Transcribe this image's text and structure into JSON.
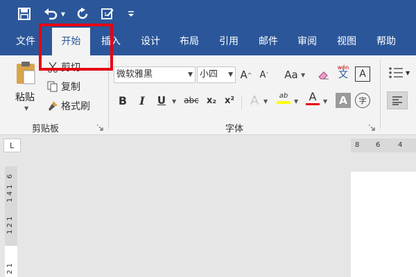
{
  "quick_access": {
    "icons": [
      "save-icon",
      "undo-icon",
      "redo-icon",
      "touch-mode-icon",
      "customize-icon"
    ]
  },
  "tabs": [
    {
      "label": "文件"
    },
    {
      "label": "开始"
    },
    {
      "label": "插入"
    },
    {
      "label": "设计"
    },
    {
      "label": "布局"
    },
    {
      "label": "引用"
    },
    {
      "label": "邮件"
    },
    {
      "label": "审阅"
    },
    {
      "label": "视图"
    },
    {
      "label": "帮助"
    }
  ],
  "clipboard": {
    "paste_label": "粘贴",
    "cut_label": "剪切",
    "copy_label": "复制",
    "format_painter_label": "格式刷",
    "group_label": "剪贴板"
  },
  "font": {
    "font_name": "微软雅黑",
    "font_size": "小四",
    "group_label": "字体",
    "change_case_label": "Aa",
    "phonetic_label": "wén",
    "phonetic_char": "文",
    "char_border_label": "A",
    "bold": "B",
    "italic": "I",
    "underline": "U",
    "strike": "abc",
    "subscript": "x₂",
    "superscript": "x²",
    "text_effects": "A",
    "highlight": "ab",
    "font_color": "A",
    "char_shading": "A",
    "enclose_char": "字",
    "grow": "A",
    "shrink": "A"
  },
  "ruler": {
    "h_ticks": [
      "8",
      "6",
      "4"
    ],
    "v_ticks": [
      "6",
      "1 4 1",
      "1 2 1",
      "2 1"
    ],
    "corner_mark": "L"
  },
  "colors": {
    "brand": "#2b579a",
    "highlight_box": "#e60012",
    "font_color_bar": "#e60012",
    "highlight_bar": "#ffff00"
  }
}
